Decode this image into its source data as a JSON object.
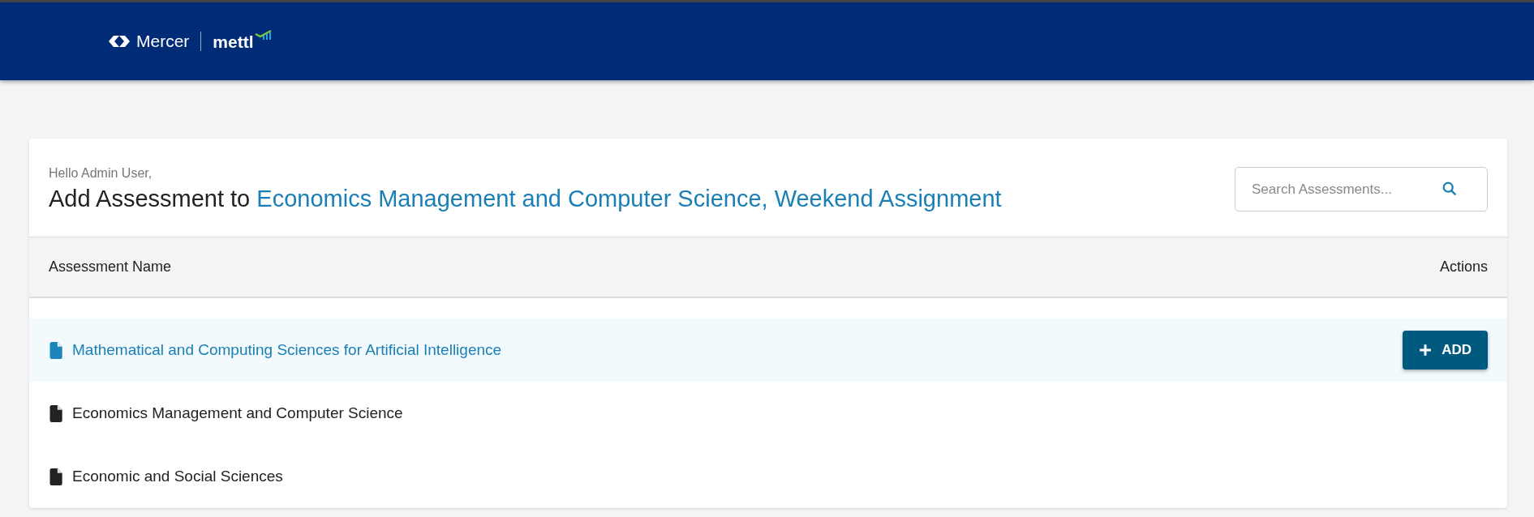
{
  "header": {
    "logo": {
      "brand": "Mercer",
      "product": "mettl"
    }
  },
  "greeting": "Hello Admin User,",
  "title": {
    "prefix": "Add Assessment to",
    "target": "Economics Management and Computer Science, Weekend Assignment"
  },
  "search": {
    "placeholder": "Search Assessments..."
  },
  "table": {
    "columns": [
      "Assessment Name",
      "Actions"
    ],
    "rows": [
      {
        "name": "Mathematical and Computing Sciences for Artificial Intelligence",
        "highlighted": true,
        "action": "ADD"
      },
      {
        "name": "Economics Management and Computer Science",
        "highlighted": false
      },
      {
        "name": "Economic and Social Sciences",
        "highlighted": false
      }
    ]
  }
}
